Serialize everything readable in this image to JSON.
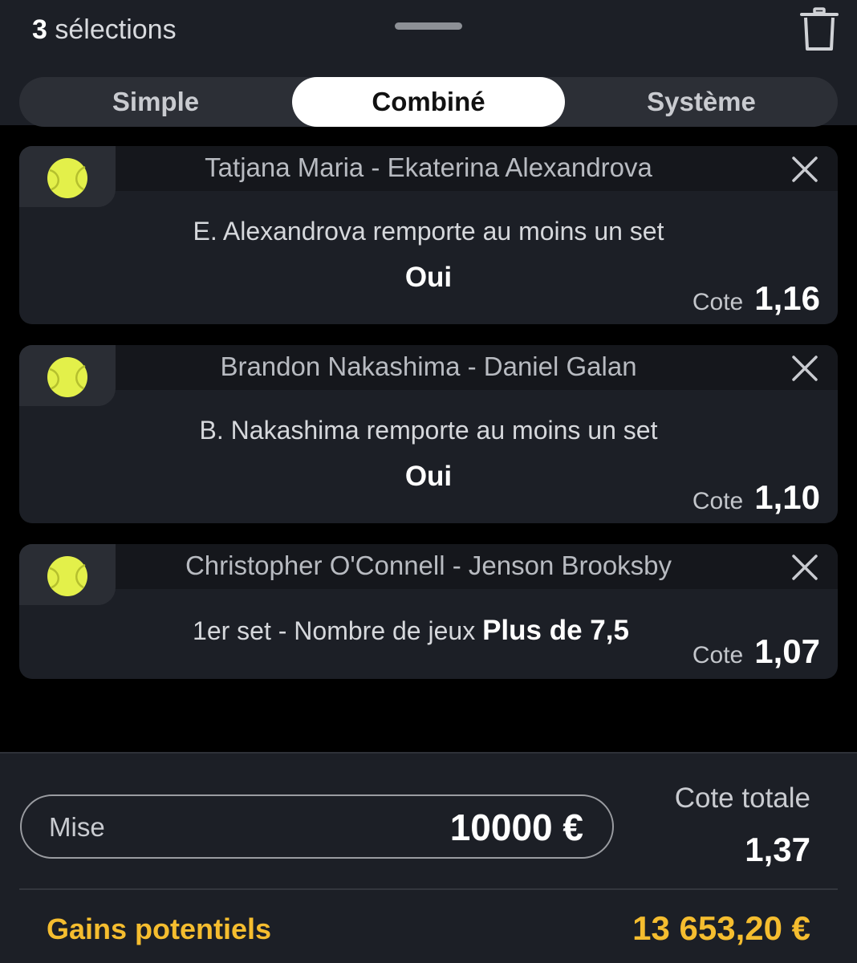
{
  "header": {
    "selection_count": "3",
    "selection_label": "sélections"
  },
  "tabs": [
    {
      "label": "Simple",
      "active": false
    },
    {
      "label": "Combiné",
      "active": true
    },
    {
      "label": "Système",
      "active": false
    }
  ],
  "bets": [
    {
      "sport_icon": "tennis-ball-icon",
      "match": "Tatjana Maria - Ekaterina Alexandrova",
      "market": "E. Alexandrova remporte au moins un set",
      "selection": "Oui",
      "odds_label": "Cote",
      "odds": "1,16"
    },
    {
      "sport_icon": "tennis-ball-icon",
      "match": "Brandon Nakashima - Daniel Galan",
      "market": "B. Nakashima remporte au moins un set",
      "selection": "Oui",
      "odds_label": "Cote",
      "odds": "1,10"
    },
    {
      "sport_icon": "tennis-ball-icon",
      "match": "Christopher O'Connell - Jenson Brooksby",
      "market": "1er set - Nombre de jeux",
      "selection": "Plus de 7,5",
      "odds_label": "Cote",
      "odds": "1,07"
    }
  ],
  "footer": {
    "stake_label": "Mise",
    "stake_value": "10000 €",
    "total_odds_label": "Cote totale",
    "total_odds": "1,37",
    "gains_label": "Gains potentiels",
    "gains_value": "13 653,20 €"
  },
  "colors": {
    "accent": "#f5bd2f",
    "tennis_ball": "#e3f04a"
  }
}
